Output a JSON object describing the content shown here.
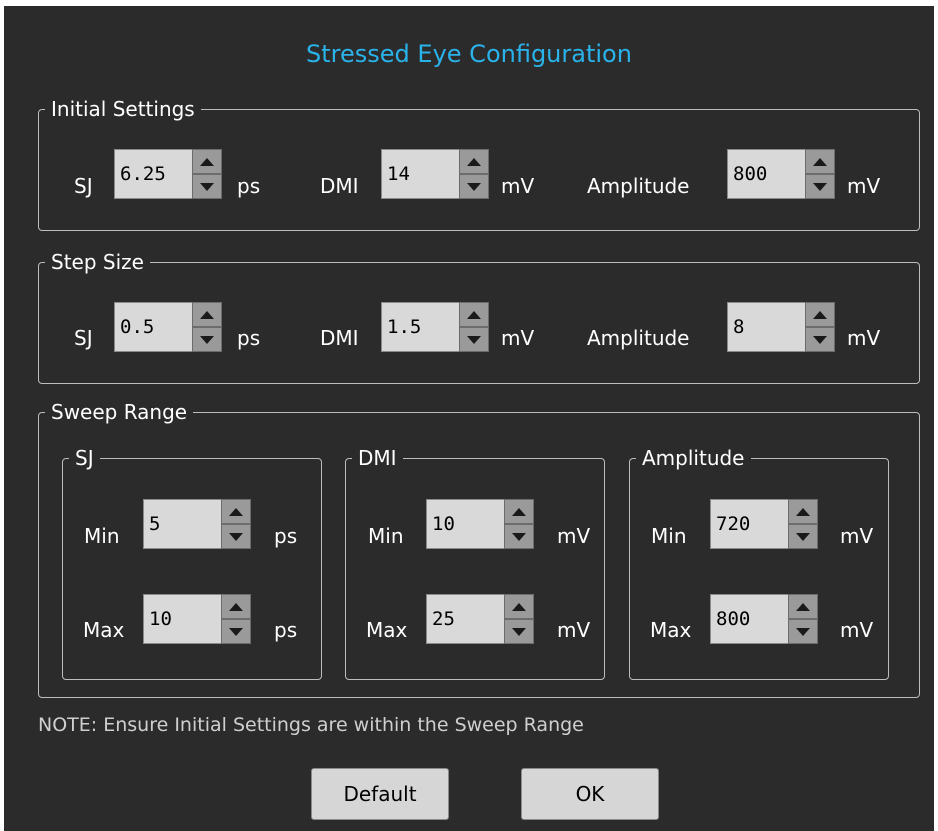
{
  "title": "Stressed Eye Configuration",
  "initial": {
    "legend": "Initial Settings",
    "sj": {
      "label": "SJ",
      "value": "6.25",
      "unit": "ps"
    },
    "dmi": {
      "label": "DMI",
      "value": "14",
      "unit": "mV"
    },
    "amp": {
      "label": "Amplitude",
      "value": "800",
      "unit": "mV"
    }
  },
  "step": {
    "legend": "Step Size",
    "sj": {
      "label": "SJ",
      "value": "0.5",
      "unit": "ps"
    },
    "dmi": {
      "label": "DMI",
      "value": "1.5",
      "unit": "mV"
    },
    "amp": {
      "label": "Amplitude",
      "value": "8",
      "unit": "mV"
    }
  },
  "sweep": {
    "legend": "Sweep Range",
    "sj": {
      "legend": "SJ",
      "min_label": "Min",
      "min": "5",
      "max_label": "Max",
      "max": "10",
      "unit": "ps"
    },
    "dmi": {
      "legend": "DMI",
      "min_label": "Min",
      "min": "10",
      "max_label": "Max",
      "max": "25",
      "unit": "mV"
    },
    "amp": {
      "legend": "Amplitude",
      "min_label": "Min",
      "min": "720",
      "max_label": "Max",
      "max": "800",
      "unit": "mV"
    }
  },
  "note": "NOTE: Ensure Initial Settings are within the Sweep Range",
  "buttons": {
    "default": "Default",
    "ok": "OK"
  },
  "colors": {
    "background": "#2b2b2b",
    "title": "#2ab3ea",
    "field": "#d9d9d9",
    "spinner": "#9a9a9a"
  }
}
